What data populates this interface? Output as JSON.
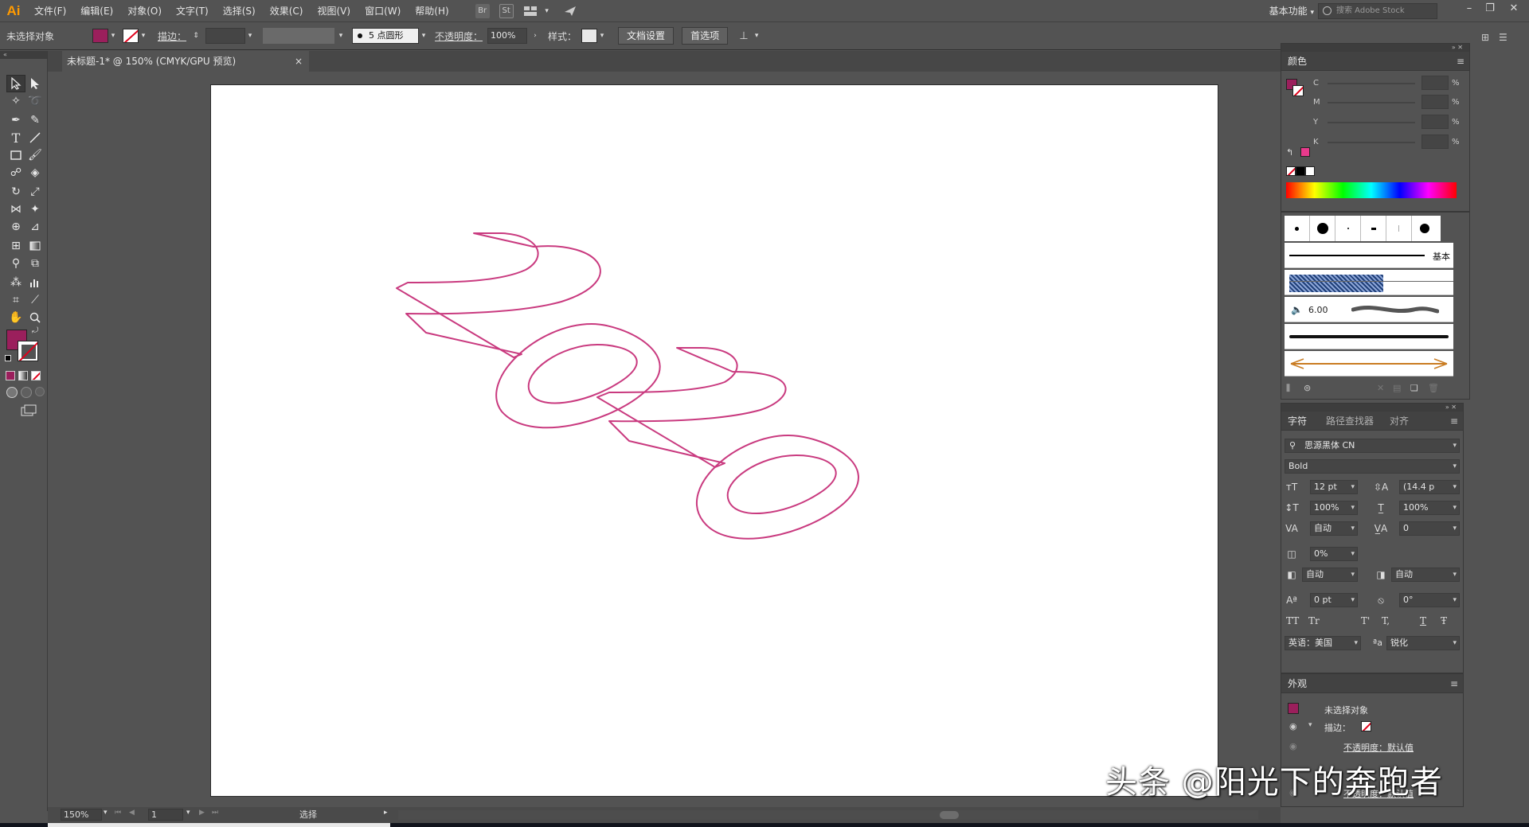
{
  "app": {
    "logo": "Ai"
  },
  "menu": [
    "文件(F)",
    "编辑(E)",
    "对象(O)",
    "文字(T)",
    "选择(S)",
    "效果(C)",
    "视图(V)",
    "窗口(W)",
    "帮助(H)"
  ],
  "menu_icons": {
    "bridge": "Br",
    "stock": "St"
  },
  "workspace": "基本功能",
  "stock_search_placeholder": "搜索 Adobe Stock",
  "control": {
    "no_selection": "未选择对象",
    "fill_color": "#9b1f5c",
    "stroke_label": "描边：",
    "brush": "5 点圆形",
    "opacity_label": "不透明度：",
    "opacity_value": "100%",
    "style_label": "样式：",
    "doc_setup": "文档设置",
    "preferences": "首选项"
  },
  "document": {
    "tab_title": "未标题-1* @ 150% (CMYK/GPU 预览)",
    "close": "×"
  },
  "artwork": {
    "text": "2020",
    "stroke_color": "#c93a7f"
  },
  "status": {
    "zoom": "150%",
    "page": "1",
    "tool": "选择"
  },
  "color_panel": {
    "title": "颜色",
    "channels": [
      {
        "label": "C",
        "pct": "%"
      },
      {
        "label": "M",
        "pct": "%"
      },
      {
        "label": "Y",
        "pct": "%"
      },
      {
        "label": "K",
        "pct": "%"
      }
    ]
  },
  "brushes_panel": {
    "basic_label": "基本",
    "size_value": "6.00"
  },
  "character_panel": {
    "tabs": [
      "字符",
      "路径查找器",
      "对齐"
    ],
    "font_family": "思源黑体 CN",
    "font_style": "Bold",
    "font_size": "12 pt",
    "leading": "(14.4 p",
    "vscale": "100%",
    "hscale": "100%",
    "kerning": "自动",
    "tracking": "0",
    "tsume": "0%",
    "aki_left": "自动",
    "aki_right": "自动",
    "baseline": "0 pt",
    "rotation": "0°",
    "case_buttons": [
      "TT",
      "Tr",
      "T'",
      "T,",
      "T",
      "Ŧ"
    ],
    "language": "英语：美国",
    "aa_icon": "ªa",
    "antialias": "锐化"
  },
  "appearance_panel": {
    "title": "外观",
    "no_selection": "未选择对象",
    "stroke_label": "描边：",
    "opacity_default": "不透明度：默认值",
    "opacity_default_2": "不透明度：默认值"
  },
  "watermark": "头条 @阳光下的奔跑者"
}
